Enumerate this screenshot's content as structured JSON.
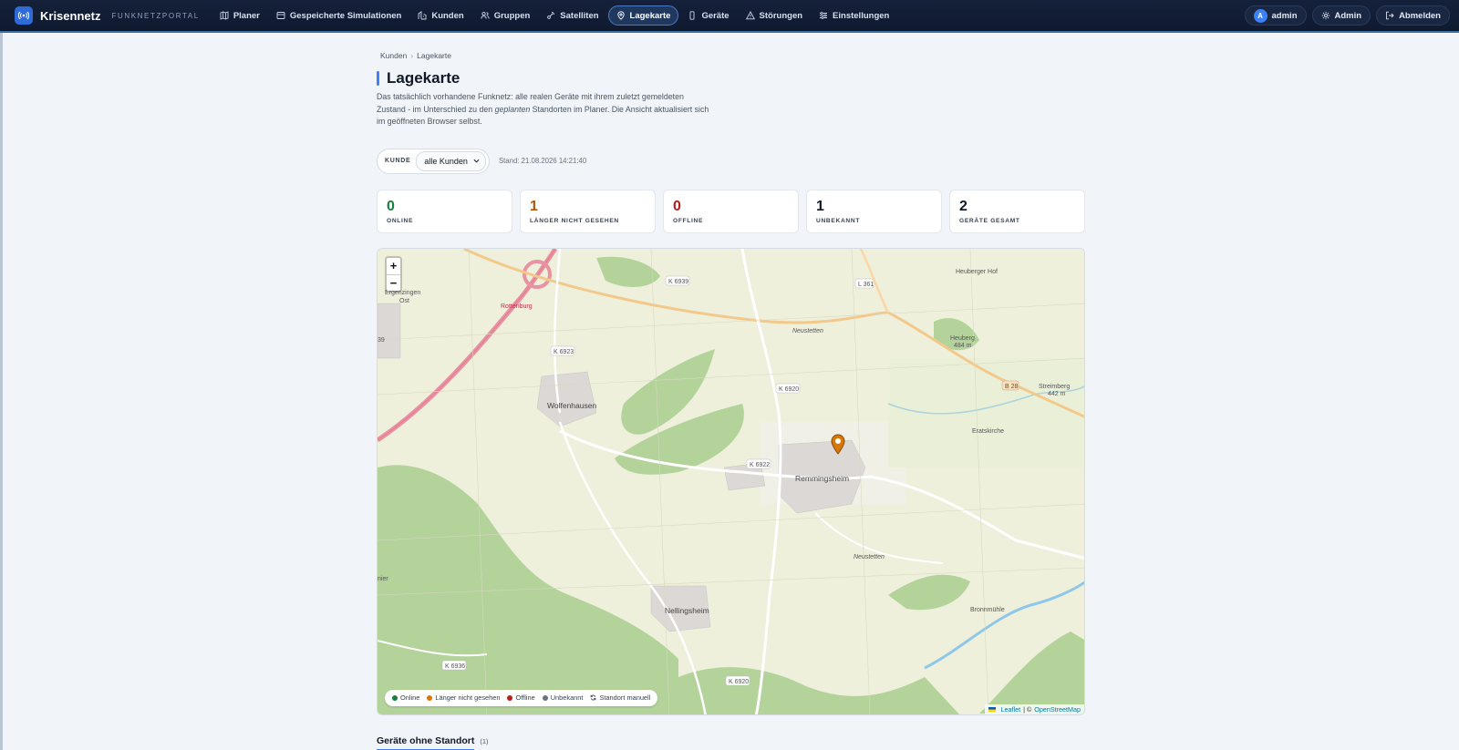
{
  "brand": {
    "name": "Krisennetz",
    "subtitle": "FUNKNETZPORTAL"
  },
  "nav": [
    {
      "label": "Planer",
      "icon": "map-icon",
      "active": false
    },
    {
      "label": "Gespeicherte Simulationen",
      "icon": "list-icon",
      "active": false
    },
    {
      "label": "Kunden",
      "icon": "building-icon",
      "active": false
    },
    {
      "label": "Gruppen",
      "icon": "users-icon",
      "active": false
    },
    {
      "label": "Satelliten",
      "icon": "satellite-icon",
      "active": false
    },
    {
      "label": "Lagekarte",
      "icon": "map-pin-icon",
      "active": true
    },
    {
      "label": "Geräte",
      "icon": "device-icon",
      "active": false
    },
    {
      "label": "Störungen",
      "icon": "warning-icon",
      "active": false
    },
    {
      "label": "Einstellungen",
      "icon": "sliders-icon",
      "active": false
    }
  ],
  "user": {
    "initial": "A",
    "name": "admin",
    "admin_label": "Admin",
    "logout_label": "Abmelden"
  },
  "breadcrumb": {
    "parent": "Kunden",
    "sep": "›",
    "current": "Lagekarte"
  },
  "page": {
    "title": "Lagekarte",
    "desc_1": "Das tatsächlich vorhandene Funknetz: alle realen Geräte mit ihrem zuletzt gemeldeten Zustand - im Unterschied zu den ",
    "desc_em": "geplanten",
    "desc_2": " Standorten im Planer. Die Ansicht aktualisiert sich im geöffneten Browser selbst."
  },
  "filter": {
    "label": "KUNDE",
    "selected": "alle Kunden",
    "stand": "Stand: 21.08.2026 14:21:40"
  },
  "stats": [
    {
      "value": "0",
      "label": "ONLINE",
      "color": "#15803d"
    },
    {
      "value": "1",
      "label": "LÄNGER NICHT GESEHEN",
      "color": "#b45309"
    },
    {
      "value": "0",
      "label": "OFFLINE",
      "color": "#b91c1c"
    },
    {
      "value": "1",
      "label": "UNBEKANNT",
      "color": "#111827"
    },
    {
      "value": "2",
      "label": "GERÄTE GESAMT",
      "color": "#111827"
    }
  ],
  "map": {
    "zoom_in": "+",
    "zoom_out": "−",
    "labels": {
      "k6939": "K 6939",
      "l361": "L 361",
      "heuberger_hof": "Heuberger Hof",
      "ergenzingen": "Ergenzingen",
      "ost": "Ost",
      "rottenburg": "Rottenburg",
      "neustetten_n": "Neustetten",
      "heuberg": "Heuberg",
      "heuberg_h": "484 m",
      "k6923": "K 6923",
      "b28": "B 28",
      "streimberg": "Streimberg",
      "streimberg_h": "442 m",
      "k6920": "K 6920",
      "wolfenhausen": "Wolfenhausen",
      "eratskirche": "Eratskirche",
      "k6922": "K 6922",
      "remmingsheim": "Remmingsheim",
      "neustetten_s": "Neustetten",
      "nellingsheim": "Nellingsheim",
      "bronnmuhle": "Bronnmühle",
      "k6936": "K 6936",
      "k6920_s": "K 6920",
      "edge_l": "39",
      "edge_l2": "nier"
    },
    "legend": [
      {
        "label": "Online",
        "color": "#15803d"
      },
      {
        "label": "Länger nicht gesehen",
        "color": "#d97706"
      },
      {
        "label": "Offline",
        "color": "#b91c1c"
      },
      {
        "label": "Unbekannt",
        "color": "#6b7280"
      },
      {
        "label": "Standort manuell",
        "icon": "refresh-icon"
      }
    ],
    "attribution": {
      "leaflet": "Leaflet",
      "sep": "| ©",
      "osm": "OpenStreetMap"
    }
  },
  "section": {
    "title": "Geräte ohne Standort",
    "count": "(1)"
  }
}
